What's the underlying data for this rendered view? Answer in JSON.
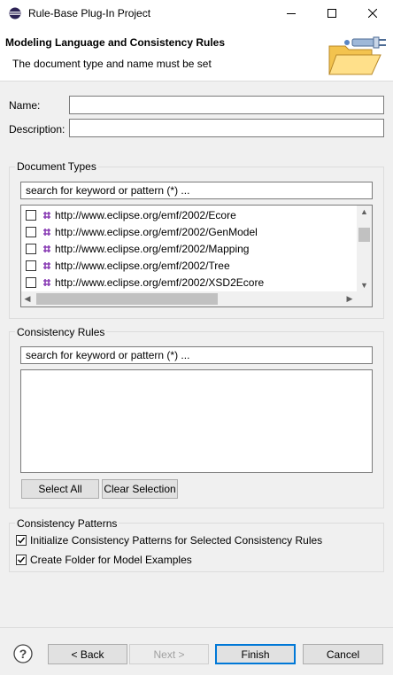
{
  "window": {
    "title": "Rule-Base Plug-In Project"
  },
  "header": {
    "title": "Modeling Language and Consistency Rules",
    "message": "The document type and name must be set"
  },
  "form": {
    "name_label": "Name:",
    "name_value": "",
    "description_label": "Description:",
    "description_value": ""
  },
  "document_types": {
    "group_title": "Document Types",
    "search_placeholder": "search for keyword or pattern (*) ...",
    "items": [
      {
        "label": "http://www.eclipse.org/emf/2002/Ecore",
        "checked": false
      },
      {
        "label": "http://www.eclipse.org/emf/2002/GenModel",
        "checked": false
      },
      {
        "label": "http://www.eclipse.org/emf/2002/Mapping",
        "checked": false
      },
      {
        "label": "http://www.eclipse.org/emf/2002/Tree",
        "checked": false
      },
      {
        "label": "http://www.eclipse.org/emf/2002/XSD2Ecore",
        "checked": false
      }
    ],
    "item_icon": "package-icon",
    "item_icon_color": "#8a3fb5"
  },
  "consistency_rules": {
    "group_title": "Consistency Rules",
    "search_placeholder": "search for keyword or pattern (*) ...",
    "select_all_label": "Select All",
    "clear_selection_label": "Clear Selection"
  },
  "consistency_patterns": {
    "group_title": "Consistency Patterns",
    "options": [
      {
        "label": "Initialize Consistency Patterns for Selected Consistency Rules",
        "checked": true
      },
      {
        "label": "Create Folder for Model Examples",
        "checked": true
      }
    ]
  },
  "footer": {
    "back_label": "< Back",
    "next_label": "Next >",
    "finish_label": "Finish",
    "cancel_label": "Cancel",
    "help_icon": "help-icon"
  },
  "colors": {
    "accent": "#0078d7",
    "background": "#f0f0f0"
  }
}
